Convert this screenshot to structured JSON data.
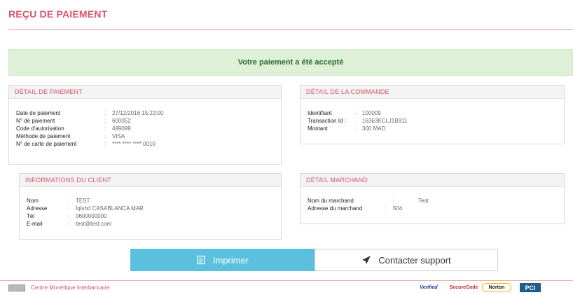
{
  "page": {
    "title": "REÇU DE PAIEMENT"
  },
  "alert": {
    "message": "Votre paiement a été accepté"
  },
  "payment_detail": {
    "heading": "DÉTAIL DE PAIEMENT",
    "rows": [
      {
        "label": "Date de paiement",
        "sep": ":",
        "value": "27/12/2016 15:22:00"
      },
      {
        "label": "N° de paiement",
        "sep": ":",
        "value": "600052"
      },
      {
        "label": "Code d'autorisation",
        "sep": ":",
        "value": "499099"
      },
      {
        "label": "Méthode de paiement",
        "sep": ":",
        "value": "VISA"
      },
      {
        "label": "N° de carte de paiement",
        "sep": ":",
        "value": "**** **** **** 0010"
      }
    ]
  },
  "order_detail": {
    "heading": "DÉTAIL DE LA COMMANDE",
    "rows": [
      {
        "label": "Identifiant",
        "sep": ":",
        "value": "100009"
      },
      {
        "label": "Transaction Id :",
        "sep": "",
        "value": "16363KCLJ1B911"
      },
      {
        "label": "Montant",
        "sep": ":",
        "value": "300 MAD"
      }
    ]
  },
  "client_info": {
    "heading": "INFORMATIONS DU CLIENT",
    "rows": [
      {
        "label": "Nom",
        "sep": ":",
        "value": "TEST"
      },
      {
        "label": "Adresse",
        "sep": ":",
        "value": "fqlshd CASABLANCA MAR"
      },
      {
        "label": "Tél",
        "sep": ":",
        "value": "0600000000"
      },
      {
        "label": "E-mail",
        "sep": ":",
        "value": "test@test.com"
      }
    ]
  },
  "merchant_detail": {
    "heading": "DÉTAIL MARCHAND",
    "rows": [
      {
        "label": "Nom du marchand",
        "sep": ":",
        "value": "Test"
      },
      {
        "label": "Adresse du marchand",
        "sep": ":",
        "value": "504"
      }
    ]
  },
  "actions": {
    "print_label": "Imprimer",
    "support_label": "Contacter support"
  },
  "footer": {
    "org": "Centre Monétique Interbancaire",
    "brands": {
      "verified": "Verified",
      "secure": "SecureCode",
      "norton": "Norton",
      "pci": "PCI"
    }
  },
  "colors": {
    "accent": "#d9546a",
    "success_bg": "#dff0d8",
    "success_text": "#2f6b2f",
    "print_button": "#5bc0de"
  },
  "icons": {
    "print": "print-icon",
    "support": "paper-plane-icon"
  }
}
